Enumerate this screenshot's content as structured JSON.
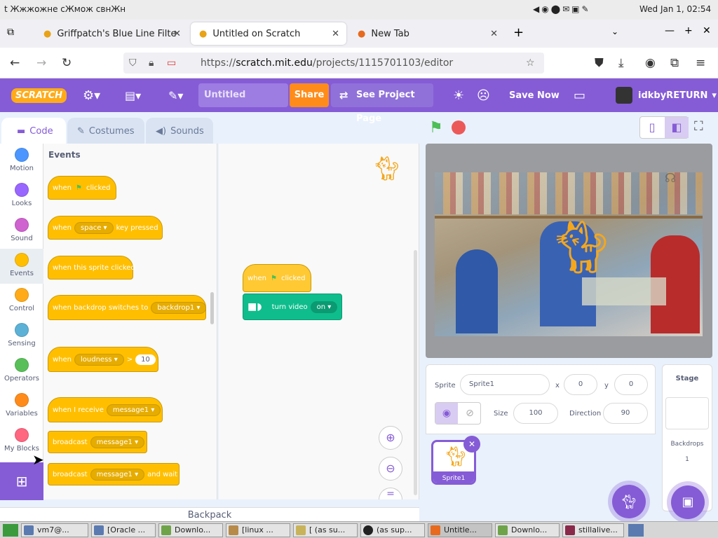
{
  "system": {
    "menu_text": "t Жжжожне сЖмож свнЖн",
    "clock": "Wed Jan 1, 02:54"
  },
  "browser": {
    "tabs": [
      {
        "label": "Griffpatch's Blue Line Filter",
        "active": false
      },
      {
        "label": "Untitled on Scratch",
        "active": true
      },
      {
        "label": "New Tab",
        "active": false
      }
    ],
    "new_tab_icon": "+",
    "url": "https://scratch.mit.edu/projects/1115701103/editor",
    "url_host": "scratch.mit.edu",
    "url_path": "/projects/1115701103/editor",
    "url_scheme": "https://"
  },
  "scratch": {
    "logo": "SCRATCH",
    "project_title": "Untitled",
    "share_label": "Share",
    "see_project_label": "See Project Page",
    "save_now_label": "Save Now",
    "username": "idkbyRETURN"
  },
  "editor_tabs": [
    {
      "label": "Code",
      "active": true
    },
    {
      "label": "Costumes",
      "active": false
    },
    {
      "label": "Sounds",
      "active": false
    }
  ],
  "categories": [
    {
      "label": "Motion",
      "color": "#4c97ff"
    },
    {
      "label": "Looks",
      "color": "#9966ff"
    },
    {
      "label": "Sound",
      "color": "#cf63cf"
    },
    {
      "label": "Events",
      "color": "#ffbf00"
    },
    {
      "label": "Control",
      "color": "#ffab19"
    },
    {
      "label": "Sensing",
      "color": "#5cb1d6"
    },
    {
      "label": "Operators",
      "color": "#59c059"
    },
    {
      "label": "Variables",
      "color": "#ff8c1a"
    },
    {
      "label": "My Blocks",
      "color": "#ff6680"
    }
  ],
  "palette": {
    "heading": "Events",
    "blocks": {
      "flag_when": "when",
      "flag_clicked": "clicked",
      "key_when": "when",
      "key_value": "space",
      "key_pressed": "key pressed",
      "sprite_clicked": "when this sprite clicked",
      "backdrop_switch": "when backdrop switches to",
      "backdrop_value": "backdrop1",
      "loud_when": "when",
      "loud_value": "loudness",
      "loud_op": ">",
      "loud_num": "10",
      "receive": "when I receive",
      "receive_value": "message1",
      "broadcast": "broadcast",
      "broadcast_value": "message1",
      "broadcast2": "broadcast",
      "broadcast2_value": "message1",
      "broadcast2_wait": "and wait"
    }
  },
  "workspace": {
    "hat_when": "when",
    "hat_clicked": "clicked",
    "video_label": "turn video",
    "video_value": "on"
  },
  "backpack_label": "Backpack",
  "sprite": {
    "sprite_label": "Sprite",
    "name": "Sprite1",
    "x_label": "x",
    "x": "0",
    "y_label": "y",
    "y": "0",
    "size_label": "Size",
    "size": "100",
    "direction_label": "Direction",
    "direction": "90",
    "thumb_label": "Sprite1"
  },
  "stage_panel": {
    "title": "Stage",
    "backdrops_label": "Backdrops",
    "backdrops_count": "1"
  },
  "taskbar": [
    {
      "label": "vm7@..."
    },
    {
      "label": "[Oracle ..."
    },
    {
      "label": "Downlo..."
    },
    {
      "label": "[linux ..."
    },
    {
      "label": "[ (as su..."
    },
    {
      "label": "(as sup..."
    },
    {
      "label": "Untitle..."
    },
    {
      "label": "Downlo..."
    },
    {
      "label": "stillalive..."
    }
  ]
}
